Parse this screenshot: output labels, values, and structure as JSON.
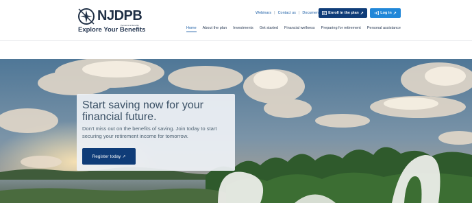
{
  "header": {
    "logo_text": "NJDPB",
    "logo_subtext": "Pensions & Benefits",
    "tagline": "Explore Your Benefits",
    "utility_links": [
      "Webinars",
      "Contact us",
      "Documents"
    ],
    "enroll_button": "Enroll in the plan",
    "login_button": "Log in",
    "nav": [
      {
        "label": "Home",
        "active": true
      },
      {
        "label": "About the plan",
        "active": false
      },
      {
        "label": "Investments",
        "active": false
      },
      {
        "label": "Get started",
        "active": false
      },
      {
        "label": "Financial wellness",
        "active": false
      },
      {
        "label": "Preparing for retirement",
        "active": false
      },
      {
        "label": "Personal assistance",
        "active": false
      }
    ]
  },
  "hero": {
    "title": "Start saving now for your financial future.",
    "text": "Don't miss out on the benefits of saving. Join today to start securing your retirement income for tomorrow.",
    "cta": "Register today"
  },
  "colors": {
    "primary": "#0f3c78",
    "accent": "#2187d8",
    "link": "#1d5fa6"
  },
  "icons": {
    "logo": "compass-icon",
    "enroll": "enroll-icon",
    "login": "login-icon",
    "external": "external-link-icon"
  }
}
